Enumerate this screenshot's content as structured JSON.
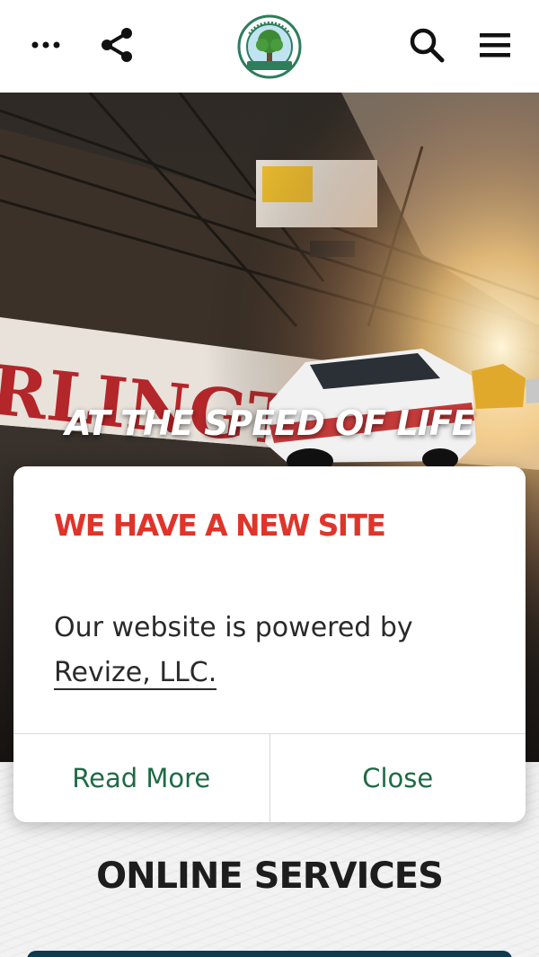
{
  "header": {
    "more_icon": "more-horizontal-icon",
    "share_icon": "share-icon",
    "logo_alt": "county-seal-logo",
    "search_icon": "search-icon",
    "menu_icon": "hamburger-menu-icon"
  },
  "hero": {
    "tagline": "AT THE SPEED OF LIFE"
  },
  "modal": {
    "title": "WE HAVE A NEW SITE",
    "body_prefix": "Our website is powered by",
    "body_link": "Revize, LLC.",
    "read_more_label": "Read More",
    "close_label": "Close"
  },
  "services": {
    "title": "ONLINE SERVICES"
  },
  "colors": {
    "accent_red": "#e0342a",
    "action_green": "#1d6b45",
    "service_bar": "#0f3a4f"
  }
}
